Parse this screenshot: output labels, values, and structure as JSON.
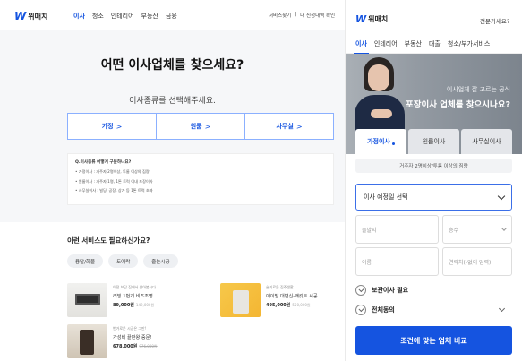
{
  "brand": {
    "mark": "W",
    "name": "위매치",
    "color": "#1554e0"
  },
  "desktop": {
    "nav": [
      "이사",
      "청소",
      "인테리어",
      "부동산",
      "금융"
    ],
    "nav_active": "이사",
    "util": [
      "서비스찾기",
      "|",
      "내 신청내역 확인"
    ],
    "hero": {
      "title": "어떤 이사업체를 찾으세요?",
      "subtitle": "이사종류를 선택해주세요."
    },
    "move_types": [
      {
        "label": "가정",
        "arrow": ">"
      },
      {
        "label": "원룸",
        "arrow": ">"
      },
      {
        "label": "사무실",
        "arrow": ">"
      }
    ],
    "info": {
      "title": "Q.이사종류 어떻게 구분하나요?",
      "lines": [
        "• 가정이사 : 거주자 2명이상, 투룸 이상의 짐량",
        "• 원룸이사 : 거주자 1명, 1톤 트럭 이내 포장이사",
        "• 사무실이사 : 빌딩, 공장, 상가 등 1톤 트럭 초과"
      ]
    },
    "extra": {
      "title": "이런 서비스도 필요하신가요?",
      "chips": [
        "용달/화물",
        "도어락",
        "줄눈시공"
      ]
    },
    "products": [
      {
        "caption": "이전 보단 집에서 살아봅시다",
        "name": "리빙 1번개 비즈조명",
        "price": "89,000원",
        "old_price": "149,000원"
      },
      {
        "caption": "슬기로운 집주생활",
        "name": "아이방 대변신-쾌킷트 시공",
        "price": "495,000원",
        "old_price": "550,000원"
      },
      {
        "caption": "번거로운 시공은 그만!",
        "name": "가성비 끝판왕 중문!",
        "price": "678,000원",
        "old_price": "976,000원"
      }
    ]
  },
  "mobile": {
    "expert_link": "전문가세요?",
    "nav": [
      "이사",
      "인테리어",
      "부동산",
      "대출",
      "청소/부가서비스"
    ],
    "nav_active": "이사",
    "banner": {
      "small": "이사업체 잘 고르는 공식",
      "big": "포장이사 업체를 찾으시나요?"
    },
    "tabs": [
      "가정이사",
      "원룸이사",
      "사무실이사"
    ],
    "tab_active": "가정이사",
    "tab_desc": "거주자 2명이상/투룸 이상의 짐량",
    "date_select": "이사 예정일 선택",
    "fields": {
      "origin": "출발지",
      "floor": "층수",
      "name": "이름",
      "phone": "연락처(-없이 입력)"
    },
    "checks": [
      "보관이사 필요",
      "전체동의"
    ],
    "cta": "조건에 맞는 업체 비교"
  }
}
